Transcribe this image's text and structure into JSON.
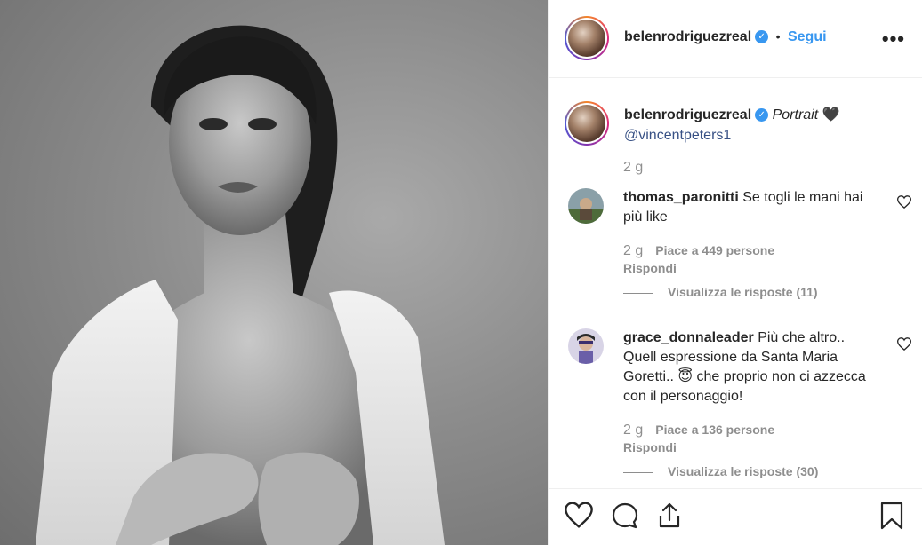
{
  "post": {
    "username": "belenrodriguezreal",
    "follow_label": "Segui",
    "dot": "•",
    "more_label": "•••"
  },
  "caption": {
    "username": "belenrodriguezreal",
    "text": "Portrait",
    "heart": "🖤",
    "mention": "@vincentpeters1",
    "time": "2 g"
  },
  "comments": [
    {
      "username": "thomas_paronitti",
      "text": "Se togli le mani hai più like",
      "time": "2 g",
      "likes": "Piace a 449 persone",
      "reply": "Rispondi",
      "view_replies": "Visualizza le risposte (11)"
    },
    {
      "username": "grace_donnaleader",
      "text": "Più che altro.. Quell espressione da Santa Maria Goretti.. 😇 che proprio non ci azzecca con il personaggio!",
      "time": "2 g",
      "likes": "Piace a 136 persone",
      "reply": "Rispondi",
      "view_replies": "Visualizza le risposte (30)"
    }
  ],
  "icons": {
    "verified": "verified-badge-icon",
    "like": "heart-outline-icon",
    "comment": "comment-bubble-icon",
    "share": "share-icon",
    "save": "bookmark-icon"
  },
  "colors": {
    "accent": "#3897f0",
    "muted": "#8e8e8e",
    "text": "#262626"
  }
}
